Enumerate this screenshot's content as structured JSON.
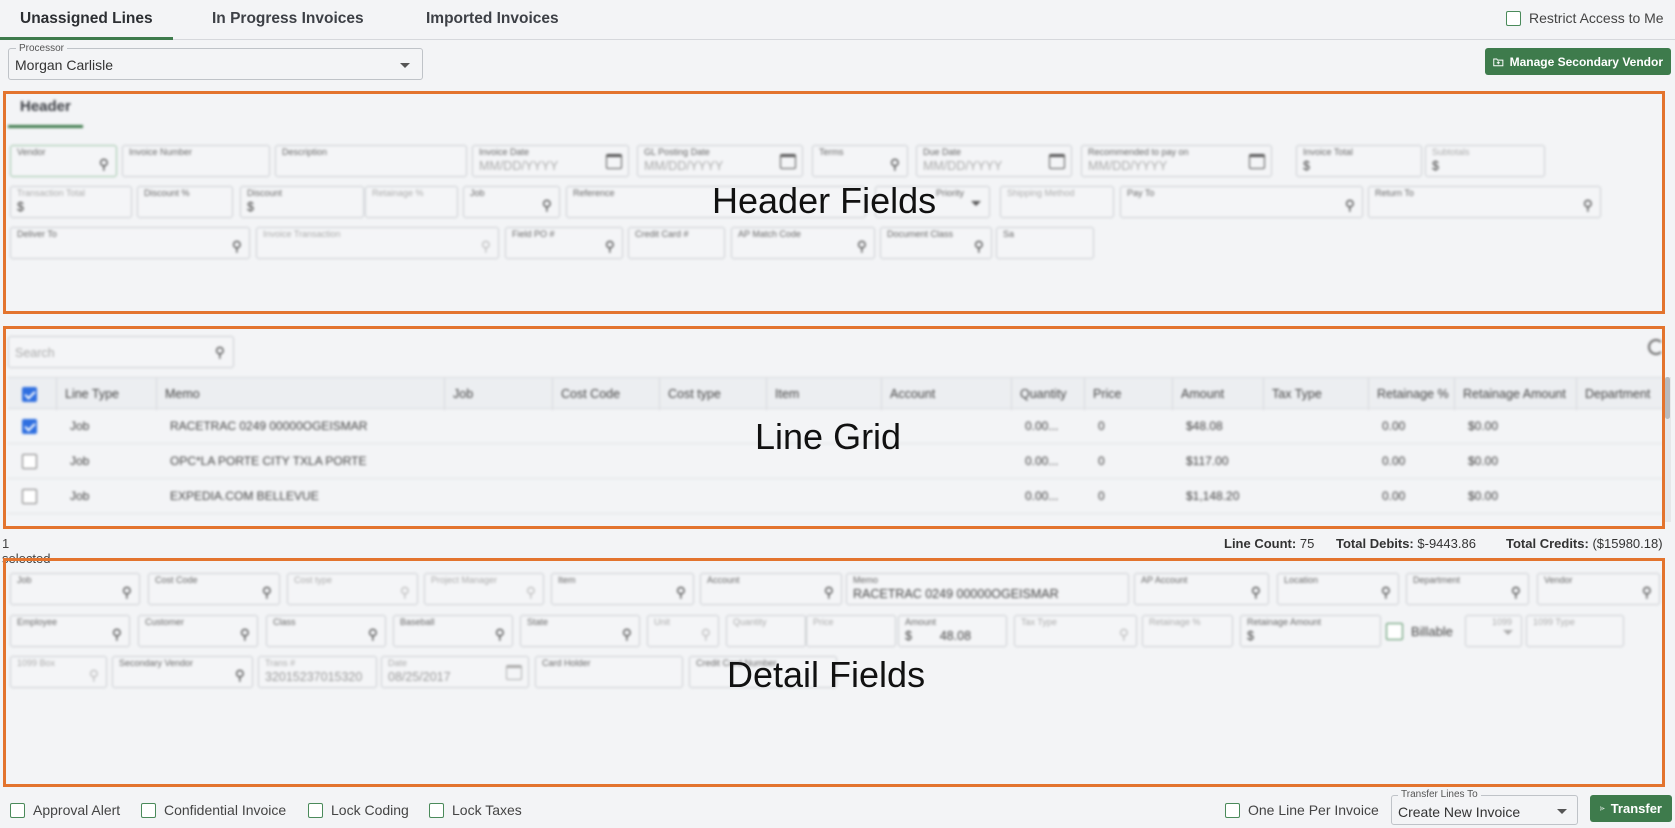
{
  "tabs": [
    {
      "label": "Unassigned Lines",
      "active": true
    },
    {
      "label": "In Progress Invoices",
      "active": false
    },
    {
      "label": "Imported Invoices",
      "active": false
    }
  ],
  "restrict_access": {
    "label": "Restrict Access to Me",
    "checked": false
  },
  "processor": {
    "label": "Processor",
    "value": "Morgan Carlisle"
  },
  "manage_vendor_button": "Manage Secondary Vendor",
  "header_panel": {
    "tab_label": "Header",
    "overlay_label": "Header Fields",
    "fields": [
      {
        "label": "Vendor",
        "value": ""
      },
      {
        "label": "Invoice Number",
        "value": ""
      },
      {
        "label": "Description",
        "value": ""
      },
      {
        "label": "Invoice Date",
        "value": "MM/DD/YYYY"
      },
      {
        "label": "GL Posting Date",
        "value": "MM/DD/YYYY"
      },
      {
        "label": "Terms",
        "value": ""
      },
      {
        "label": "Due Date",
        "value": "MM/DD/YYYY"
      },
      {
        "label": "Recommended to pay on",
        "value": "MM/DD/YYYY"
      },
      {
        "label": "Invoice Total",
        "value": "$"
      },
      {
        "label": "Subtotals",
        "value": "$"
      },
      {
        "label": "Transaction Total",
        "value": "$"
      },
      {
        "label": "Discount %",
        "value": ""
      },
      {
        "label": "Discount",
        "value": "$"
      },
      {
        "label": "Retainage %",
        "value": ""
      },
      {
        "label": "Job",
        "value": ""
      },
      {
        "label": "Reference",
        "value": ""
      },
      {
        "label": "Priority",
        "value": ""
      },
      {
        "label": "Shipping Method",
        "value": ""
      },
      {
        "label": "Pay To",
        "value": ""
      },
      {
        "label": "Return To",
        "value": ""
      },
      {
        "label": "Deliver To",
        "value": ""
      },
      {
        "label": "Invoice Transaction",
        "value": ""
      },
      {
        "label": "Field PO #",
        "value": ""
      },
      {
        "label": "Credit Card #",
        "value": ""
      },
      {
        "label": "AP Match Code",
        "value": ""
      },
      {
        "label": "Document Class",
        "value": ""
      },
      {
        "label": "Sa",
        "value": ""
      }
    ]
  },
  "line_grid": {
    "overlay_label": "Line Grid",
    "search_placeholder": "Search",
    "columns": [
      "Line Type",
      "Memo",
      "Job",
      "Cost Code",
      "Cost type",
      "Item",
      "Account",
      "Quantity",
      "Price",
      "Amount",
      "Tax Type",
      "Retainage %",
      "Retainage Amount",
      "Department"
    ],
    "rows": [
      {
        "checked": true,
        "line_type": "Job",
        "memo": "RACETRAC 0249 00000OGEISMAR",
        "quantity": "0.00...",
        "price": "0",
        "amount": "$48.08",
        "retainage_pct": "0.00",
        "retainage_amount": "$0.00"
      },
      {
        "checked": false,
        "line_type": "Job",
        "memo": "OPC*LA PORTE CITY TXLA PORTE",
        "quantity": "0.00...",
        "price": "0",
        "amount": "$117.00",
        "retainage_pct": "0.00",
        "retainage_amount": "$0.00"
      },
      {
        "checked": false,
        "line_type": "Job",
        "memo": "EXPEDIA.COM BELLEVUE",
        "quantity": "0.00...",
        "price": "0",
        "amount": "$1,148.20",
        "retainage_pct": "0.00",
        "retainage_amount": "$0.00"
      }
    ],
    "selected_text": "1 selected",
    "line_count_label": "Line Count:",
    "line_count_value": "75",
    "total_debits_label": "Total Debits:",
    "total_debits_value": "$-9443.86",
    "total_credits_label": "Total Credits:",
    "total_credits_value": "($15980.18)"
  },
  "detail_panel": {
    "overlay_label": "Detail Fields",
    "fields": [
      {
        "label": "Job",
        "value": ""
      },
      {
        "label": "Cost Code",
        "value": ""
      },
      {
        "label": "Cost type",
        "value": ""
      },
      {
        "label": "Project Manager",
        "value": ""
      },
      {
        "label": "Item",
        "value": ""
      },
      {
        "label": "Account",
        "value": ""
      },
      {
        "label": "Memo",
        "value": "RACETRAC 0249 00000OGEISMAR"
      },
      {
        "label": "AP Account",
        "value": ""
      },
      {
        "label": "Location",
        "value": ""
      },
      {
        "label": "Department",
        "value": ""
      },
      {
        "label": "Vendor",
        "value": ""
      },
      {
        "label": "Employee",
        "value": ""
      },
      {
        "label": "Customer",
        "value": ""
      },
      {
        "label": "Class",
        "value": ""
      },
      {
        "label": "Baseball",
        "value": ""
      },
      {
        "label": "State",
        "value": ""
      },
      {
        "label": "Unit",
        "value": ""
      },
      {
        "label": "Quantity",
        "value": ""
      },
      {
        "label": "Price",
        "value": ""
      },
      {
        "label": "Amount",
        "value": "$        48.08"
      },
      {
        "label": "Tax Type",
        "value": ""
      },
      {
        "label": "Retainage %",
        "value": ""
      },
      {
        "label": "Retainage Amount",
        "value": "$"
      },
      {
        "label": "1099",
        "value": ""
      },
      {
        "label": "1099 Type",
        "value": ""
      },
      {
        "label": "1099 Box",
        "value": ""
      },
      {
        "label": "Secondary Vendor",
        "value": ""
      },
      {
        "label": "Trans #",
        "value": "32015237015320"
      },
      {
        "label": "Date",
        "value": "08/25/2017"
      },
      {
        "label": "Card Holder",
        "value": ""
      },
      {
        "label": "Credit Card Number",
        "value": ""
      }
    ],
    "billable_label": "Billable"
  },
  "bottom_bar": {
    "checkboxes": [
      {
        "label": "Approval Alert",
        "checked": false
      },
      {
        "label": "Confidential Invoice",
        "checked": false
      },
      {
        "label": "Lock Coding",
        "checked": false
      },
      {
        "label": "Lock Taxes",
        "checked": false
      }
    ],
    "one_line_per_invoice": {
      "label": "One Line Per Invoice",
      "checked": false
    },
    "transfer_lines_to": {
      "label": "Transfer Lines To",
      "value": "Create New Invoice"
    },
    "transfer_button": "Transfer"
  },
  "colors": {
    "accent_green": "#3e7b4c",
    "highlight_orange": "#e3742e",
    "checkbox_blue": "#2f6fe0"
  }
}
